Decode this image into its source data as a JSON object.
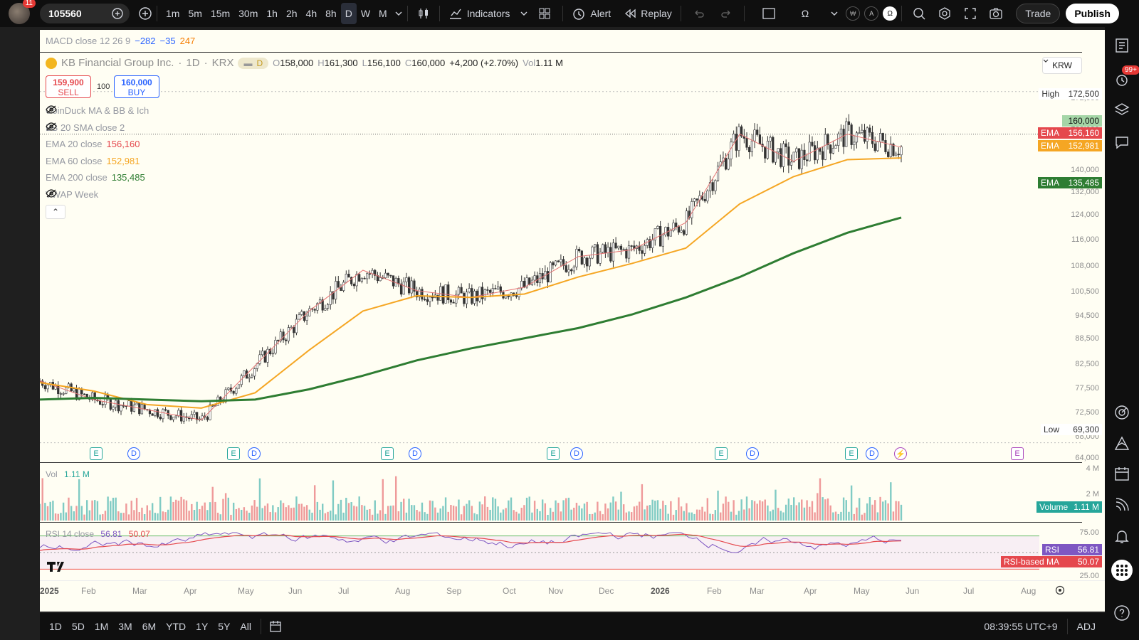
{
  "toolbar": {
    "avatar_badge": "11",
    "symbol": "105560",
    "intervals": [
      "1m",
      "5m",
      "15m",
      "30m",
      "1h",
      "2h",
      "4h",
      "8h",
      "D",
      "W",
      "M"
    ],
    "selected_interval": "D",
    "indicators_label": "Indicators",
    "alert_label": "Alert",
    "replay_label": "Replay",
    "omega": "Ω",
    "mini_a": "A",
    "mini_omega": "Ω",
    "trade_label": "Trade",
    "publish_label": "Publish"
  },
  "chart": {
    "macd_legend": {
      "label": "MACD close 12 26 9",
      "v1": "−282",
      "v2": "−35",
      "v3": "247",
      "c1": "#2962ff",
      "c2": "#2962ff",
      "c3": "#f57c00"
    },
    "header": {
      "name": "KB Financial Group Inc.",
      "interval": "1D",
      "exchange": "KRX",
      "pill": "D",
      "o_label": "O",
      "o": "158,000",
      "h_label": "H",
      "h": "161,300",
      "l_label": "L",
      "l": "156,100",
      "c_label": "C",
      "c": "160,000",
      "change": "+4,200 (+2.70%)",
      "vol_label": "Vol",
      "vol": "1.11 M"
    },
    "sell": {
      "price": "159,900",
      "label": "SELL"
    },
    "qty": "100",
    "buy": {
      "price": "160,000",
      "label": "BUY"
    },
    "currency": "KRW",
    "legends": [
      {
        "label": "CoinDuck MA & BB & Ich",
        "value": "",
        "color": "#9598a1",
        "hidden": true
      },
      {
        "label": "BB 20 SMA close 2",
        "value": "",
        "color": "#9598a1",
        "hidden": true
      },
      {
        "label": "EMA 20 close",
        "value": "156,160",
        "color": "#e5484d",
        "hidden": false
      },
      {
        "label": "EMA 60 close",
        "value": "152,981",
        "color": "#f5a623",
        "hidden": false
      },
      {
        "label": "EMA 200 close",
        "value": "135,485",
        "color": "#2e7d32",
        "hidden": false
      },
      {
        "label": "VWAP Week",
        "value": "",
        "color": "#9598a1",
        "hidden": true
      }
    ],
    "collapse_glyph": "⌃",
    "high": {
      "label": "High",
      "value": "172,500"
    },
    "low": {
      "label": "Low",
      "value": "69,300"
    },
    "last_price": "160,000",
    "ema_tags": [
      {
        "name": "EMA",
        "value": "156,160",
        "color": "#e5484d"
      },
      {
        "name": "EMA",
        "value": "152,981",
        "color": "#f5a623"
      },
      {
        "name": "EMA",
        "value": "135,485",
        "color": "#2e7d32"
      }
    ],
    "price_axis": [
      "172,500",
      "160,000",
      "140,000",
      "132,000",
      "124,000",
      "116,000",
      "108,000",
      "100,500",
      "94,500",
      "88,500",
      "82,500",
      "77,500",
      "72,500",
      "68,000",
      "64,000"
    ],
    "months": [
      "2025",
      "Feb",
      "Mar",
      "Apr",
      "May",
      "Jun",
      "Jul",
      "Aug",
      "Sep",
      "Oct",
      "Nov",
      "Dec",
      "2026",
      "Feb",
      "Mar",
      "Apr",
      "May",
      "Jun",
      "Jul",
      "Aug"
    ],
    "events": [
      "E",
      "D",
      "E",
      "D",
      "E",
      "D",
      "E",
      "D",
      "E",
      "D",
      "E",
      "D",
      "⚡",
      "E"
    ],
    "volume": {
      "label": "Vol",
      "value": "1.11 M",
      "axis": [
        "4 M",
        "2 M"
      ],
      "tag_name": "Volume",
      "tag_value": "1.11 M"
    },
    "rsi": {
      "label": "RSI 14 close",
      "v1": "56.81",
      "v2": "50.07",
      "axis": [
        "75.00",
        "25.00"
      ],
      "tag_rsi": "RSI",
      "tag_rsi_val": "56.81",
      "tag_ma": "RSI-based MA",
      "tag_ma_val": "50.07"
    }
  },
  "chart_data": {
    "type": "line",
    "categories": [
      "2025-01",
      "2025-02",
      "2025-03",
      "2025-04",
      "2025-05",
      "2025-06",
      "2025-07",
      "2025-08",
      "2025-09",
      "2025-10",
      "2025-11",
      "2025-12",
      "2026-01",
      "2026-02",
      "2026-03",
      "2026-04",
      "2026-05"
    ],
    "series": [
      {
        "name": "EMA 20 close",
        "values": [
          87500,
          82000,
          79000,
          76000,
          92000,
          108000,
          120000,
          114000,
          112000,
          115000,
          124000,
          126000,
          134000,
          160000,
          152000,
          160000,
          156160
        ]
      },
      {
        "name": "EMA 60 close",
        "values": [
          87000,
          84500,
          80500,
          79500,
          84000,
          96500,
          108000,
          112500,
          112000,
          113000,
          118000,
          122000,
          126500,
          139500,
          147500,
          152500,
          152981
        ]
      },
      {
        "name": "EMA 200 close",
        "values": [
          82000,
          82500,
          82000,
          81500,
          82000,
          85000,
          89000,
          93500,
          97000,
          100000,
          103000,
          107000,
          112000,
          118000,
          125000,
          131000,
          135485
        ]
      }
    ],
    "ylim": [
      64000,
      176000
    ],
    "high": 172500,
    "low": 69300,
    "last": 160000
  },
  "bottom": {
    "ranges": [
      "1D",
      "5D",
      "1M",
      "3M",
      "6M",
      "YTD",
      "1Y",
      "5Y",
      "All"
    ],
    "time": "08:39:55 UTC+9",
    "adj": "ADJ"
  },
  "rightbar": {
    "badge": "99+"
  }
}
